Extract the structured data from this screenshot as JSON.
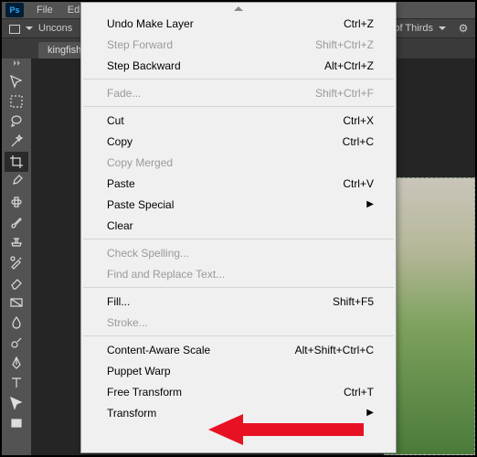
{
  "menubar": {
    "items": [
      "File",
      "Edit"
    ]
  },
  "optionsbar": {
    "preset": "Uncons",
    "guide": "Rule of Thirds"
  },
  "tab": {
    "name": "kingfisher."
  },
  "tools": [
    {
      "name": "move-tool"
    },
    {
      "name": "marquee-tool"
    },
    {
      "name": "lasso-tool"
    },
    {
      "name": "magic-wand-tool"
    },
    {
      "name": "crop-tool",
      "active": true
    },
    {
      "name": "eyedropper-tool"
    },
    {
      "name": "spot-heal-tool"
    },
    {
      "name": "brush-tool"
    },
    {
      "name": "clone-stamp-tool"
    },
    {
      "name": "history-brush-tool"
    },
    {
      "name": "eraser-tool"
    },
    {
      "name": "gradient-tool"
    },
    {
      "name": "blur-tool"
    },
    {
      "name": "dodge-tool"
    },
    {
      "name": "pen-tool"
    },
    {
      "name": "type-tool"
    },
    {
      "name": "path-tool"
    },
    {
      "name": "rectangle-tool"
    }
  ],
  "menu": {
    "groups": [
      [
        {
          "label": "Undo Make Layer",
          "shortcut": "Ctrl+Z",
          "enabled": true
        },
        {
          "label": "Step Forward",
          "shortcut": "Shift+Ctrl+Z",
          "enabled": false
        },
        {
          "label": "Step Backward",
          "shortcut": "Alt+Ctrl+Z",
          "enabled": true
        }
      ],
      [
        {
          "label": "Fade...",
          "shortcut": "Shift+Ctrl+F",
          "enabled": false
        }
      ],
      [
        {
          "label": "Cut",
          "shortcut": "Ctrl+X",
          "enabled": true
        },
        {
          "label": "Copy",
          "shortcut": "Ctrl+C",
          "enabled": true
        },
        {
          "label": "Copy Merged",
          "shortcut": "",
          "enabled": false
        },
        {
          "label": "Paste",
          "shortcut": "Ctrl+V",
          "enabled": true
        },
        {
          "label": "Paste Special",
          "shortcut": "",
          "enabled": true,
          "submenu": true
        },
        {
          "label": "Clear",
          "shortcut": "",
          "enabled": true
        }
      ],
      [
        {
          "label": "Check Spelling...",
          "shortcut": "",
          "enabled": false
        },
        {
          "label": "Find and Replace Text...",
          "shortcut": "",
          "enabled": false
        }
      ],
      [
        {
          "label": "Fill...",
          "shortcut": "Shift+F5",
          "enabled": true
        },
        {
          "label": "Stroke...",
          "shortcut": "",
          "enabled": false
        }
      ],
      [
        {
          "label": "Content-Aware Scale",
          "shortcut": "Alt+Shift+Ctrl+C",
          "enabled": true
        },
        {
          "label": "Puppet Warp",
          "shortcut": "",
          "enabled": true
        },
        {
          "label": "Free Transform",
          "shortcut": "Ctrl+T",
          "enabled": true
        },
        {
          "label": "Transform",
          "shortcut": "",
          "enabled": true,
          "submenu": true
        }
      ]
    ]
  }
}
